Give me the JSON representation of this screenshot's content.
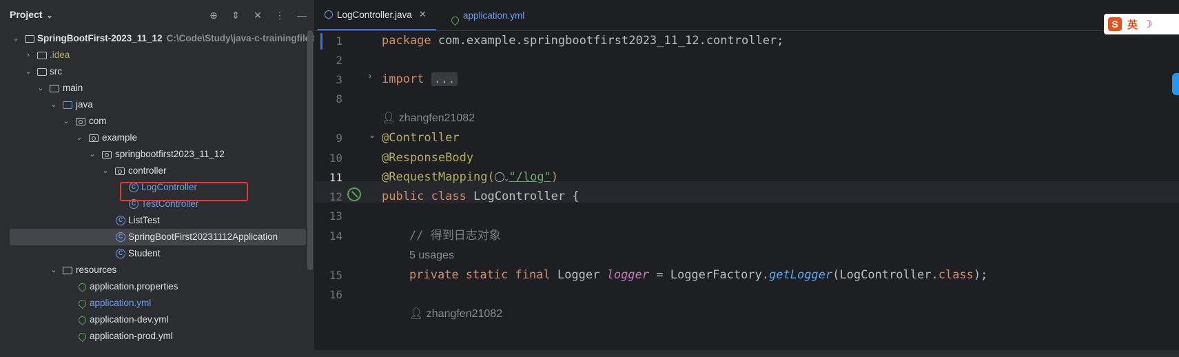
{
  "project_panel": {
    "title": "Project",
    "tree": [
      {
        "label": "SpringBootFirst-2023_11_12",
        "path": "C:\\Code\\Study\\java-c-trainingfile\\Sp",
        "type": "module",
        "expanded": true
      },
      {
        "label": ".idea",
        "type": "folder",
        "expanded": false
      },
      {
        "label": "src",
        "type": "folder",
        "expanded": true
      },
      {
        "label": "main",
        "type": "folder",
        "expanded": true
      },
      {
        "label": "java",
        "type": "folder-blue",
        "expanded": true
      },
      {
        "label": "com",
        "type": "package",
        "expanded": true
      },
      {
        "label": "example",
        "type": "package",
        "expanded": true
      },
      {
        "label": "springbootfirst2023_11_12",
        "type": "package",
        "expanded": true
      },
      {
        "label": "controller",
        "type": "package",
        "expanded": true
      },
      {
        "label": "LogController",
        "type": "class"
      },
      {
        "label": "TestController",
        "type": "class"
      },
      {
        "label": "ListTest",
        "type": "class"
      },
      {
        "label": "SpringBootFirst20231112Application",
        "type": "class",
        "selected": true
      },
      {
        "label": "Student",
        "type": "class"
      },
      {
        "label": "resources",
        "type": "folder",
        "expanded": true
      },
      {
        "label": "application.properties",
        "type": "leaf"
      },
      {
        "label": "application.yml",
        "type": "leaf"
      },
      {
        "label": "application-dev.yml",
        "type": "leaf"
      },
      {
        "label": "application-prod.yml",
        "type": "leaf"
      }
    ]
  },
  "editor": {
    "tabs": [
      {
        "label": "LogController.java",
        "active": true
      },
      {
        "label": "application.yml",
        "active": false
      }
    ],
    "line_numbers": [
      "1",
      "2",
      "3",
      "8",
      "9",
      "10",
      "11",
      "12",
      "13",
      "14",
      "15",
      "16"
    ],
    "code": {
      "l1_kw": "package",
      "l1_rest": " com.example.springbootfirst2023_11_12.controller;",
      "l3_kw": "import",
      "l3_fold": "...",
      "author1": "zhangfen21082",
      "l9": "@Controller",
      "l10": "@ResponseBody",
      "l11_ann": "@RequestMapping(",
      "l11_str": "\"/log\"",
      "l11_close": ")",
      "l12_kw": "public class",
      "l12_rest": " LogController {",
      "l14": "// 得到日志对象",
      "usages": "5 usages",
      "l15_kw": "private static final",
      "l15_type": " Logger ",
      "l15_field": "logger",
      "l15_eq": " = LoggerFactory.",
      "l15_method": "getLogger",
      "l15_arg": "(LogController.",
      "l15_class_kw": "class",
      "l15_end": ");",
      "author2": "zhangfen21082"
    }
  },
  "ime": {
    "logo": "S",
    "mode": "英"
  },
  "colors": {
    "accent": "#3574f0",
    "highlight": "#e03c3c"
  }
}
